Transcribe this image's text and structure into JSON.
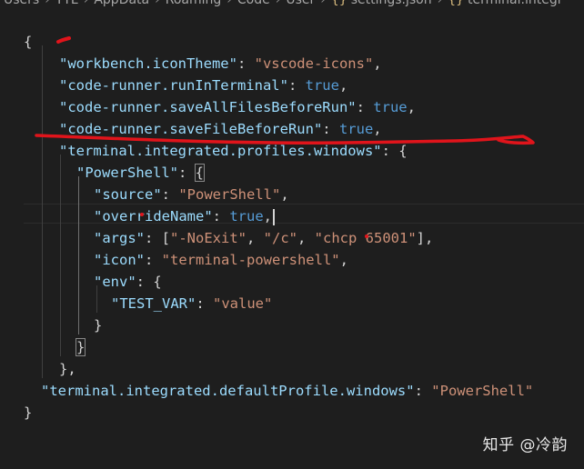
{
  "breadcrumb": {
    "items": [
      "Users",
      "YYL",
      "AppData",
      "Roaming",
      "Code",
      "User"
    ],
    "file_braces": "{}",
    "file": "settings.json",
    "symbol_braces": "{}",
    "symbol": "terminal.integr"
  },
  "code": {
    "open_brace": "{",
    "l1_key": "\"workbench.iconTheme\"",
    "l1_val": "\"vscode-icons\"",
    "l2_key": "\"code-runner.runInTerminal\"",
    "l2_val": "true",
    "l3_key": "\"code-runner.saveAllFilesBeforeRun\"",
    "l3_val": "true",
    "l4_key": "\"code-runner.saveFileBeforeRun\"",
    "l4_val": "true",
    "l5_key": "\"terminal.integrated.profiles.windows\"",
    "l6_key": "\"PowerShell\"",
    "l7_key": "\"source\"",
    "l7_val": "\"PowerShell\"",
    "l8_key": "\"overrideName\"",
    "l8_val": "true",
    "l9_key": "\"args\"",
    "l9_v1": "\"-NoExit\"",
    "l9_v2": "\"/c\"",
    "l9_v3": "\"chcp 65001\"",
    "l10_key": "\"icon\"",
    "l10_val": "\"terminal-powershell\"",
    "l11_key": "\"env\"",
    "l12_key": "\"TEST_VAR\"",
    "l12_val": "\"value\"",
    "l16_key": "\"terminal.integrated.defaultProfile.windows\"",
    "l16_val": "\"PowerShell\"",
    "close_brace": "}"
  },
  "watermark": {
    "text": "知乎 @冷韵"
  },
  "colors": {
    "background": "#1e1e1e",
    "key": "#9cdcfe",
    "string": "#ce9178",
    "boolean": "#569cd6",
    "punctuation": "#d4d4d4",
    "annotation": "#e0141b"
  }
}
